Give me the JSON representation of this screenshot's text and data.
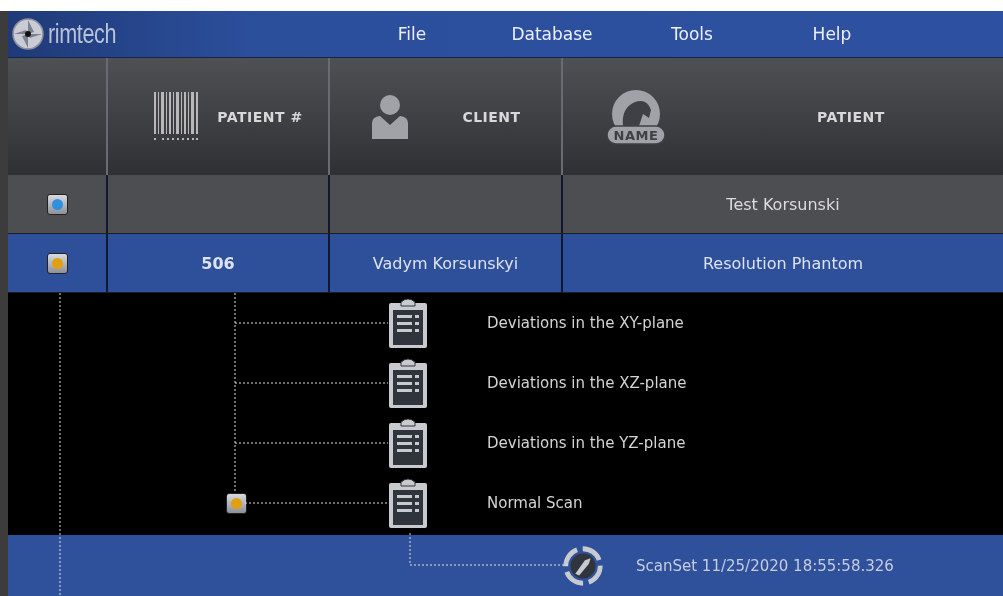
{
  "logo": {
    "text": "rimtech"
  },
  "menu": [
    {
      "label": "File"
    },
    {
      "label": "Database"
    },
    {
      "label": "Tools"
    },
    {
      "label": "Help"
    }
  ],
  "table": {
    "columns": [
      {
        "kind": "barcode",
        "label": "PATIENT #"
      },
      {
        "kind": "person",
        "label": "CLIENT"
      },
      {
        "kind": "horse",
        "label": "PATIENT",
        "icon_label": "NAME"
      }
    ],
    "rows": [
      {
        "color": "#2f8fe0",
        "patient": "Test Korsunski",
        "selected": false
      },
      {
        "color": "#e0a010",
        "patient_number": "506",
        "client": "Vadym Korsunskyi",
        "patient": "Resolution Phantom",
        "selected": true
      }
    ]
  },
  "scan_set": {
    "label": "ScanSet 11/25/2020 18:55:58.326",
    "scans": [
      {
        "label": "Deviations in the XY-plane"
      },
      {
        "label": "Deviations in the XZ-plane"
      },
      {
        "label": "Deviations in the YZ-plane"
      },
      {
        "label": "Normal Scan",
        "color": "#e0a010"
      }
    ]
  }
}
